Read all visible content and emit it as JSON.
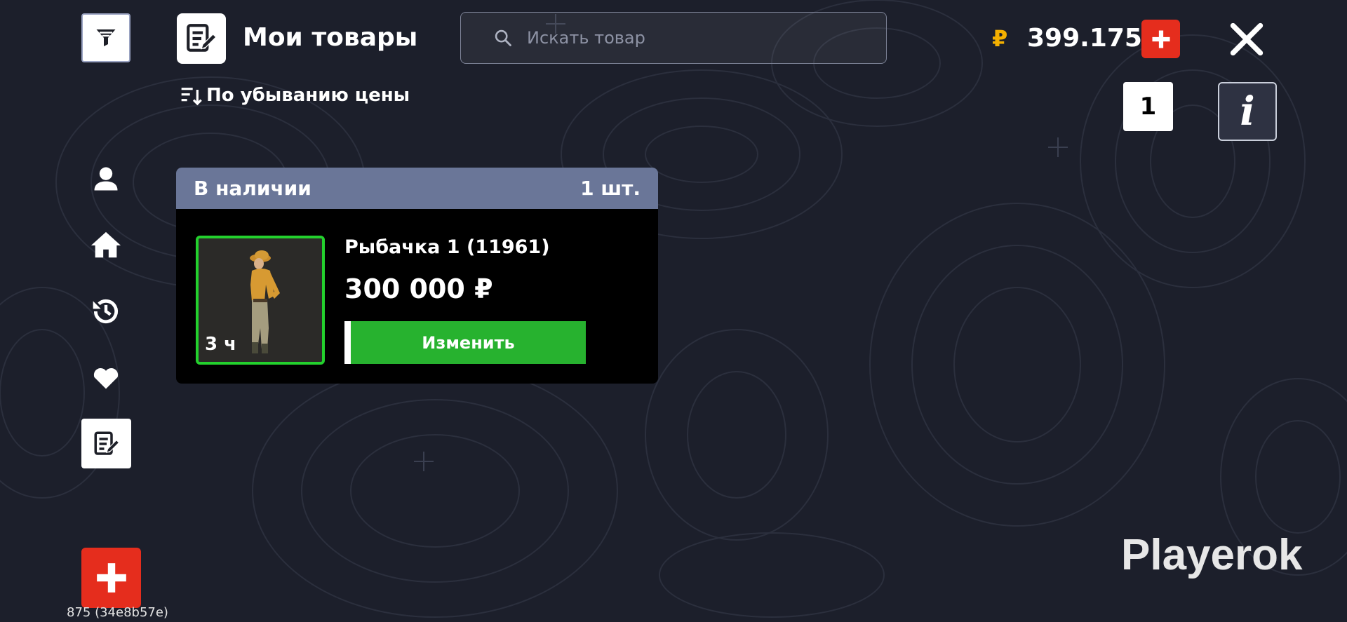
{
  "header": {
    "title": "Мои товары",
    "search_placeholder": "Искать товар",
    "currency_symbol": "₽",
    "balance": "399.175"
  },
  "sort": {
    "label": "По убыванию цены"
  },
  "counter": {
    "value": "1"
  },
  "info": {
    "label": "i"
  },
  "sidebar": {
    "items": [
      {
        "name": "profile",
        "icon": "user-icon"
      },
      {
        "name": "home",
        "icon": "home-icon"
      },
      {
        "name": "history",
        "icon": "history-icon"
      },
      {
        "name": "favorites",
        "icon": "heart-icon"
      },
      {
        "name": "my-items",
        "icon": "notes-edit-icon",
        "active": true
      }
    ]
  },
  "listing": {
    "section_label": "В наличии",
    "section_count": "1 шт.",
    "item": {
      "name": "Рыбачка 1 (11961)",
      "price": "300 000 ₽",
      "time_left": "3 ч",
      "action_label": "Изменить"
    }
  },
  "brand": "Playerok",
  "build_info": "875 (34e8b57e)",
  "colors": {
    "background": "#1c1f2b",
    "accent_red": "#e52d1d",
    "accent_green": "#27b22f",
    "currency_gold": "#f4b000",
    "card_header": "#6a7698"
  }
}
